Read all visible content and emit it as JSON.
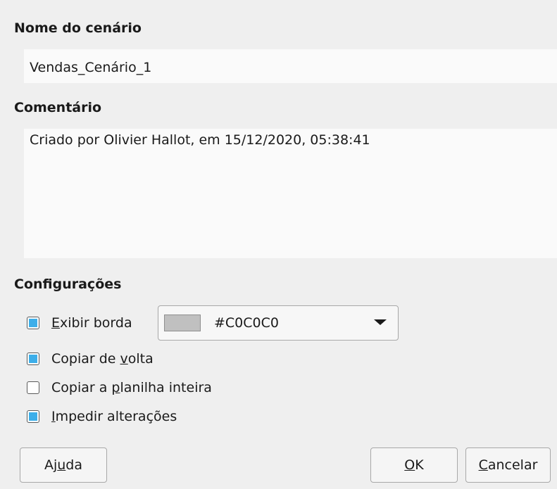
{
  "scenario_name": {
    "label": "Nome do cenário",
    "value": "Vendas_Cenário_1"
  },
  "comment": {
    "label": "Comentário",
    "value": "Criado por Olivier Hallot, em 15/12/2020, 05:38:41"
  },
  "settings": {
    "label": "Configurações",
    "show_border": {
      "mnemonic": "E",
      "rest": "xibir borda",
      "checked": true
    },
    "border_color": {
      "value": "#C0C0C0",
      "swatch": "#c0c0c0"
    },
    "copy_back": {
      "before": "Copiar de ",
      "mnemonic": "v",
      "after": "olta",
      "checked": true
    },
    "copy_entire_sheet": {
      "before": "Copiar a ",
      "mnemonic": "p",
      "after": "lanilha inteira",
      "checked": false
    },
    "prevent_changes": {
      "mnemonic": "I",
      "rest": "mpedir alterações",
      "checked": true
    }
  },
  "buttons": {
    "help": {
      "before": "Aj",
      "mnemonic": "u",
      "after": "da"
    },
    "ok": {
      "mnemonic": "O",
      "after": "K"
    },
    "cancel": {
      "mnemonic": "C",
      "after": "ancelar"
    }
  },
  "colors": {
    "accent": "#3daee9",
    "background": "#efefef"
  }
}
